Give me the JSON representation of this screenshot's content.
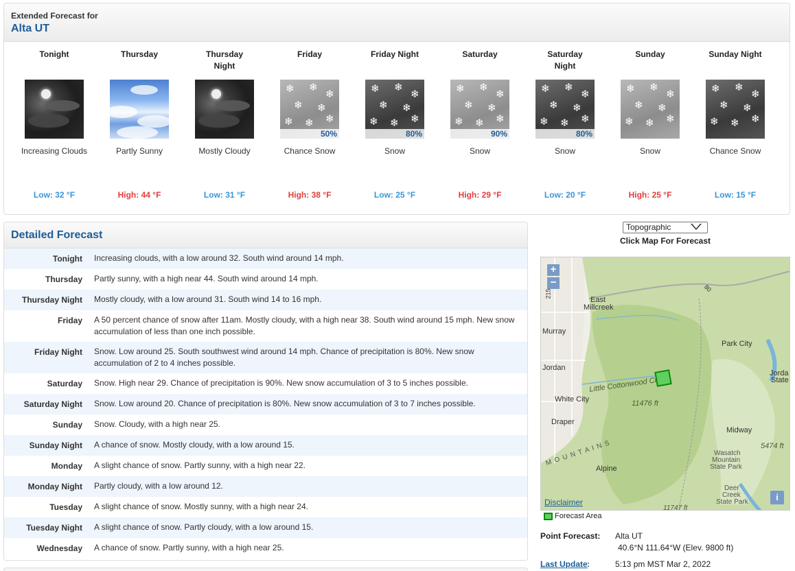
{
  "extended": {
    "small_title": "Extended Forecast for",
    "location": "Alta UT",
    "periods": [
      {
        "name": "Tonight",
        "icon": "night-clouds-icon",
        "pop": "",
        "short": "Increasing Clouds",
        "temp": "Low: 32 °F",
        "temp_type": "low"
      },
      {
        "name": "Thursday",
        "icon": "partly-sunny-icon",
        "pop": "",
        "short": "Partly Sunny",
        "temp": "High: 44 °F",
        "temp_type": "high"
      },
      {
        "name": "Thursday Night",
        "icon": "night-clouds-icon",
        "pop": "",
        "short": "Mostly Cloudy",
        "temp": "Low: 31 °F",
        "temp_type": "low"
      },
      {
        "name": "Friday",
        "icon": "snow-icon",
        "pop": "50%",
        "short": "Chance Snow",
        "temp": "High: 38 °F",
        "temp_type": "high"
      },
      {
        "name": "Friday Night",
        "icon": "snow-icon",
        "pop": "80%",
        "short": "Snow",
        "temp": "Low: 25 °F",
        "temp_type": "low"
      },
      {
        "name": "Saturday",
        "icon": "snow-icon",
        "pop": "90%",
        "short": "Snow",
        "temp": "High: 29 °F",
        "temp_type": "high"
      },
      {
        "name": "Saturday Night",
        "icon": "snow-icon",
        "pop": "80%",
        "short": "Snow",
        "temp": "Low: 20 °F",
        "temp_type": "low"
      },
      {
        "name": "Sunday",
        "icon": "snow-icon",
        "pop": "",
        "short": "Snow",
        "temp": "High: 25 °F",
        "temp_type": "high"
      },
      {
        "name": "Sunday Night",
        "icon": "snow-icon",
        "pop": "",
        "short": "Chance Snow",
        "temp": "Low: 15 °F",
        "temp_type": "low"
      }
    ]
  },
  "detailed": {
    "title": "Detailed Forecast",
    "rows": [
      {
        "label": "Tonight",
        "text": "Increasing clouds, with a low around 32. South wind around 14 mph."
      },
      {
        "label": "Thursday",
        "text": "Partly sunny, with a high near 44. South wind around 14 mph."
      },
      {
        "label": "Thursday Night",
        "text": "Mostly cloudy, with a low around 31. South wind 14 to 16 mph."
      },
      {
        "label": "Friday",
        "text": "A 50 percent chance of snow after 11am. Mostly cloudy, with a high near 38. South wind around 15 mph. New snow accumulation of less than one inch possible."
      },
      {
        "label": "Friday Night",
        "text": "Snow. Low around 25. South southwest wind around 14 mph. Chance of precipitation is 80%. New snow accumulation of 2 to 4 inches possible."
      },
      {
        "label": "Saturday",
        "text": "Snow. High near 29. Chance of precipitation is 90%. New snow accumulation of 3 to 5 inches possible."
      },
      {
        "label": "Saturday Night",
        "text": "Snow. Low around 20. Chance of precipitation is 80%. New snow accumulation of 3 to 7 inches possible."
      },
      {
        "label": "Sunday",
        "text": "Snow. Cloudy, with a high near 25."
      },
      {
        "label": "Sunday Night",
        "text": "A chance of snow. Mostly cloudy, with a low around 15."
      },
      {
        "label": "Monday",
        "text": "A slight chance of snow. Partly sunny, with a high near 22."
      },
      {
        "label": "Monday Night",
        "text": "Partly cloudy, with a low around 12."
      },
      {
        "label": "Tuesday",
        "text": "A slight chance of snow. Mostly sunny, with a high near 24."
      },
      {
        "label": "Tuesday Night",
        "text": "A slight chance of snow. Partly cloudy, with a low around 15."
      },
      {
        "label": "Wednesday",
        "text": "A chance of snow. Partly sunny, with a high near 25."
      }
    ]
  },
  "map": {
    "select_value": "Topographic",
    "caption": "Click Map For Forecast",
    "zoom_in": "+",
    "zoom_out": "−",
    "disclaimer": "Disclaimer",
    "info": "i",
    "legend": "Forecast Area",
    "labels": {
      "east_millcreek_1": "East",
      "east_millcreek_2": "Millcreek",
      "murray": "Murray",
      "park_city": "Park City",
      "jordan": "Jordan",
      "jordanelle_1": "Jorda",
      "jordanelle_2": "State",
      "little_cottonwood": "Little Cottonwood Cr",
      "white_city": "White City",
      "elev_11476": "11476 ft",
      "draper": "Draper",
      "midway": "Midway",
      "elev_5474": "5474 ft",
      "wasatch_1": "Wasatch",
      "wasatch_2": "Mountain",
      "wasatch_3": "State Park",
      "mountains": "M O U N T A I N S",
      "alpine": "Alpine",
      "deer_creek_1": "Deer",
      "deer_creek_2": "Creek",
      "deer_creek_3": "State Park",
      "elev_11747": "11747 ft",
      "road_80": "80",
      "road_215": "215"
    },
    "colors": {
      "forecast_area_fill": "#5fd05f",
      "forecast_area_stroke": "#0a8a0a",
      "accent": "#1d5d97"
    }
  },
  "point_forecast": {
    "label": "Point Forecast:",
    "location": "Alta UT",
    "coords": "40.6°N 111.64°W (Elev. 9800 ft)",
    "last_update_label": "Last Update",
    "last_update_colon": ":",
    "last_update_value": "5:13 pm MST Mar 2, 2022"
  }
}
